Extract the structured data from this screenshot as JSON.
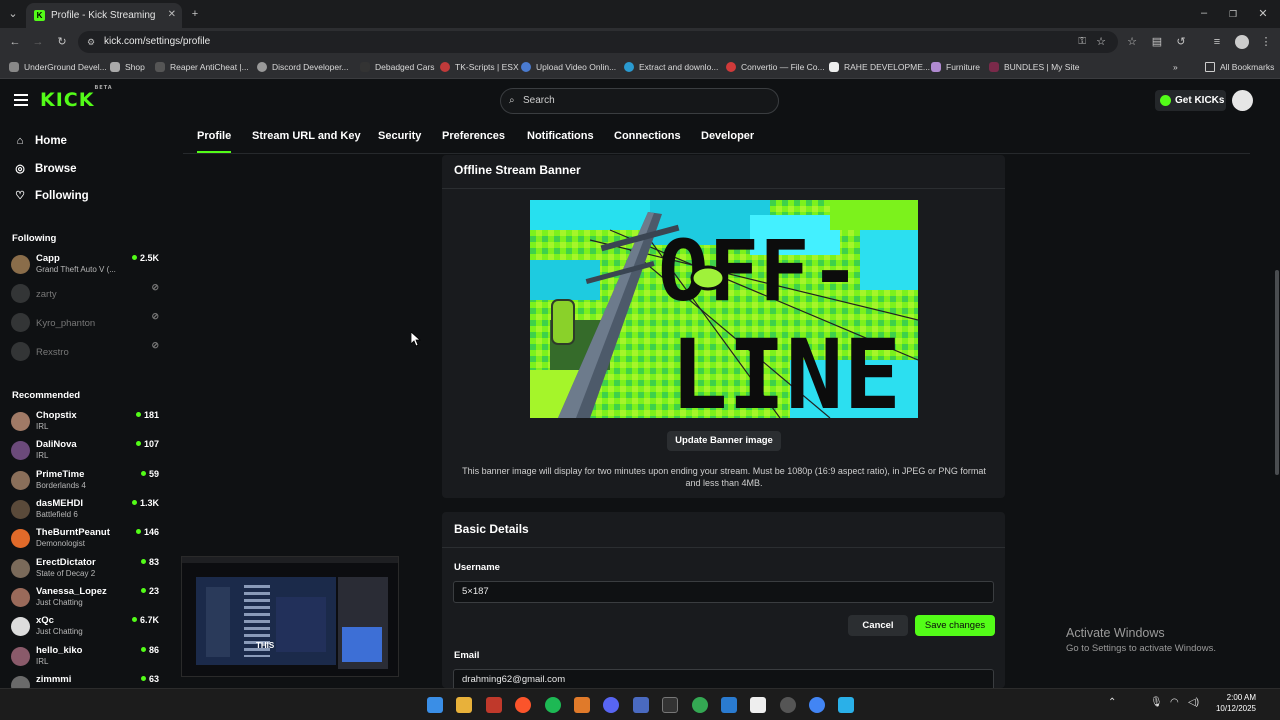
{
  "browser": {
    "tab_title": "Profile - Kick Streaming",
    "url": "kick.com/settings/profile",
    "bookmarks": [
      "UnderGround Devel...",
      "Shop",
      "Reaper AntiCheat |...",
      "Discord Developer...",
      "Debadged Cars",
      "TK-Scripts | ESX",
      "Upload Video Onlin...",
      "Extract and downlo...",
      "Convertio — File Co...",
      "RAHE DEVELOPME...",
      "Furniture",
      "BUNDLES | My Site"
    ],
    "all_bookmarks": "All Bookmarks"
  },
  "header": {
    "logo": "KICK",
    "logo_beta": "BETA",
    "search_placeholder": "Search",
    "get_kicks": "Get KICKs"
  },
  "sidebar": {
    "nav": [
      {
        "label": "Home",
        "icon": "home-icon"
      },
      {
        "label": "Browse",
        "icon": "compass-icon"
      },
      {
        "label": "Following",
        "icon": "heart-icon"
      }
    ],
    "following_title": "Following",
    "following": [
      {
        "name": "Capp",
        "game": "Grand Theft Auto V (...",
        "viewers": "2.5K",
        "live": true,
        "color": "#8a6d4a"
      },
      {
        "name": "zarty",
        "live": false,
        "color": "#777"
      },
      {
        "name": "Kyro_phanton",
        "live": false,
        "color": "#777"
      },
      {
        "name": "Rexstro",
        "live": false,
        "color": "#777"
      }
    ],
    "recommended_title": "Recommended",
    "recommended": [
      {
        "name": "Chopstix",
        "game": "IRL",
        "viewers": "181",
        "color": "#a07a66"
      },
      {
        "name": "DaliNova",
        "game": "IRL",
        "viewers": "107",
        "color": "#6b4a7a"
      },
      {
        "name": "PrimeTime",
        "game": "Borderlands 4",
        "viewers": "59",
        "color": "#8a6f5a"
      },
      {
        "name": "dasMEHDI",
        "game": "Battlefield 6",
        "viewers": "1.3K",
        "color": "#5a4a3a"
      },
      {
        "name": "TheBurntPeanut",
        "game": "Demonologist",
        "viewers": "146",
        "color": "#e06a2a"
      },
      {
        "name": "ErectDictator",
        "game": "State of Decay 2",
        "viewers": "83",
        "color": "#7a6a5a"
      },
      {
        "name": "Vanessa_Lopez",
        "game": "Just Chatting",
        "viewers": "23",
        "color": "#9a6a5a"
      },
      {
        "name": "xQc",
        "game": "Just Chatting",
        "viewers": "6.7K",
        "color": "#dcdcdc"
      },
      {
        "name": "hello_kiko",
        "game": "IRL",
        "viewers": "86",
        "color": "#8a5a6a"
      },
      {
        "name": "zimmmi",
        "game": "",
        "viewers": "63",
        "color": "#6a6a6a"
      }
    ]
  },
  "settings_tabs": [
    "Profile",
    "Stream URL and Key",
    "Security",
    "Preferences",
    "Notifications",
    "Connections",
    "Developer"
  ],
  "offline_banner": {
    "title": "Offline Stream Banner",
    "art_text_1": "OFF-",
    "art_text_2": "LINE",
    "update_button": "Update Banner image",
    "hint": "This banner image will display for two minutes upon ending your stream. Must be 1080p (16:9 aspect ratio), in JPEG or PNG format and less than 4MB."
  },
  "basic_details": {
    "title": "Basic Details",
    "username_label": "Username",
    "username_value": "5×187",
    "cancel": "Cancel",
    "save": "Save changes",
    "email_label": "Email",
    "email_value": "drahming62@gmail.com"
  },
  "pip": {
    "caption": "THIS"
  },
  "watermark": {
    "line1": "Activate Windows",
    "line2": "Go to Settings to activate Windows."
  },
  "taskbar": {
    "time": "2:00 AM",
    "date": "10/12/2025"
  },
  "colors": {
    "accent": "#53fc18",
    "background": "#0f1113",
    "card": "#191b1e"
  }
}
